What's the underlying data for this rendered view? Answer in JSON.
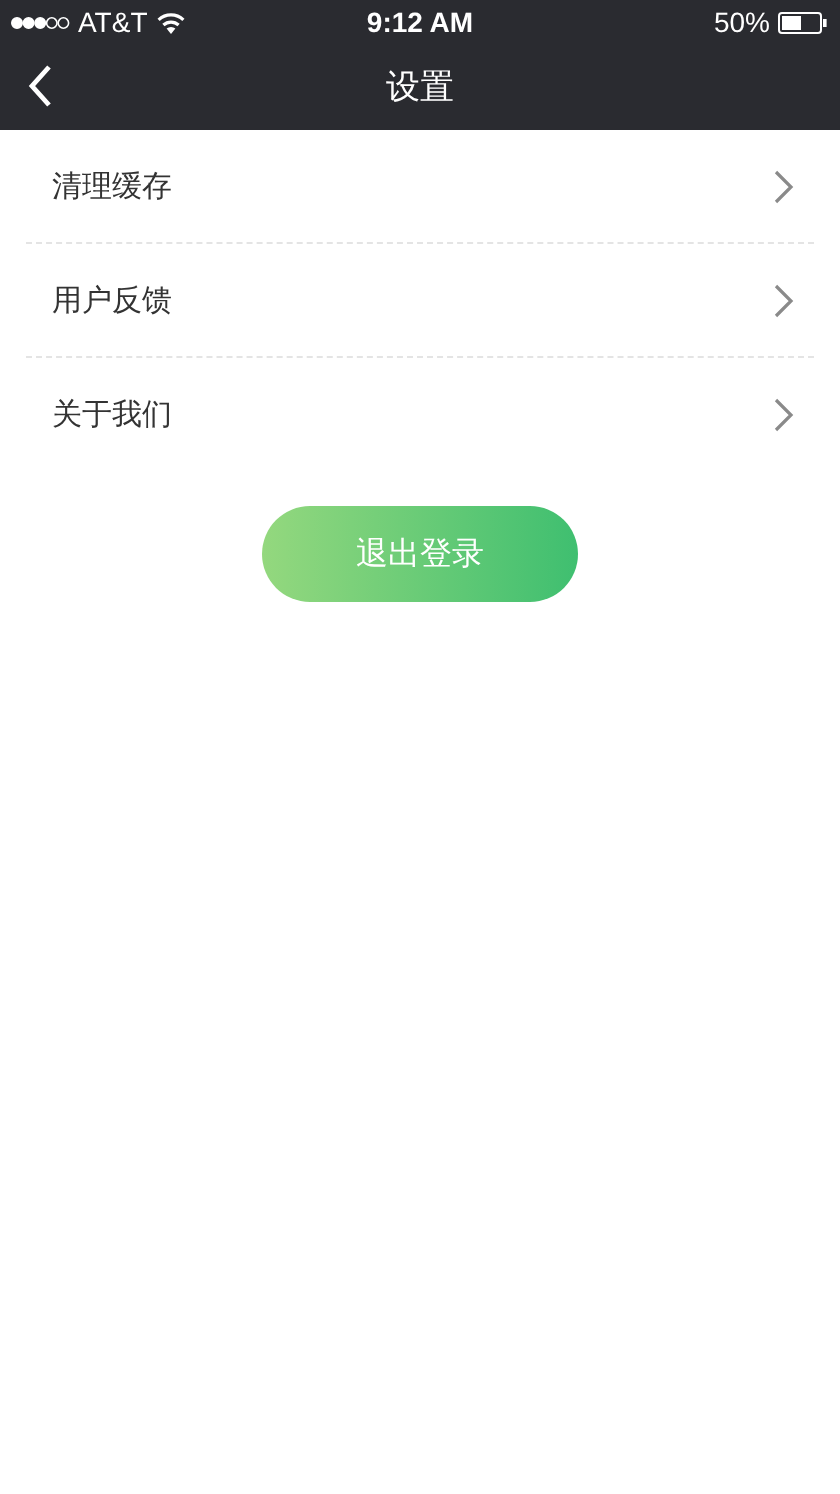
{
  "status_bar": {
    "carrier": "AT&T",
    "time": "9:12 AM",
    "battery": "50%"
  },
  "nav_bar": {
    "title": "设置"
  },
  "settings": [
    {
      "label": "清理缓存"
    },
    {
      "label": "用户反馈"
    },
    {
      "label": "关于我们"
    }
  ],
  "logout_button": "退出登录"
}
